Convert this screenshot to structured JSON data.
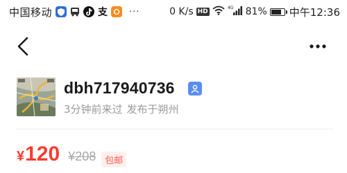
{
  "status_bar": {
    "carrier": "中国移动",
    "net_speed": "0 K/s",
    "hd_label": "HD",
    "network_type": "4G",
    "battery_percent": "81%",
    "battery_level": 0.81,
    "time": "中午12:36"
  },
  "nav": {
    "back_icon": "chevron-left-icon",
    "more_icon": "more-horizontal-icon"
  },
  "seller": {
    "name": "dbh717940736",
    "last_seen": "3分钟前来过",
    "location": "发布于朔州",
    "badge_icon": "verified-user-icon"
  },
  "price": {
    "currency": "¥",
    "value": "120",
    "original": "¥208",
    "shipping": "包邮",
    "accent_color": "#ff3b30"
  }
}
